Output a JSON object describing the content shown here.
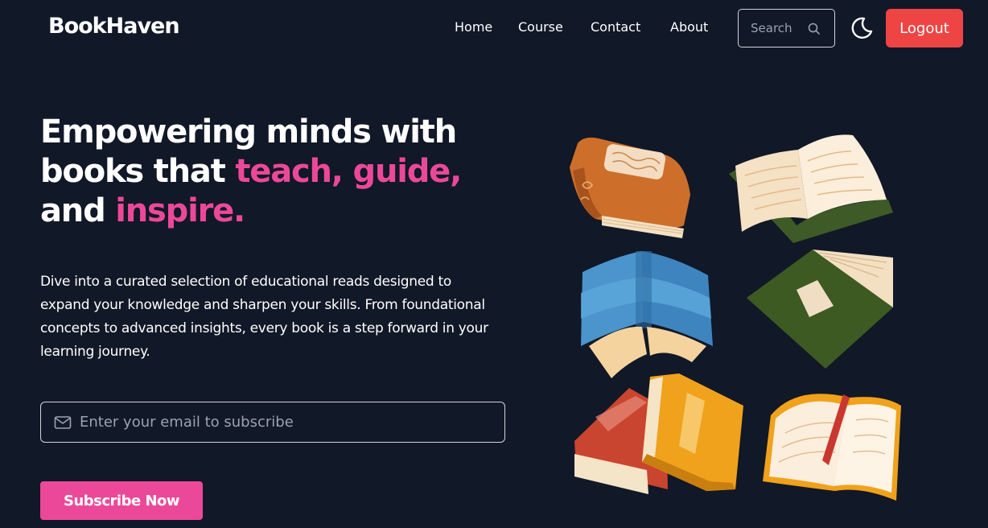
{
  "navbar": {
    "brand": "BookHaven",
    "links": [
      {
        "label": "Home"
      },
      {
        "label": "Course"
      },
      {
        "label": "Contact"
      },
      {
        "label": "About"
      }
    ],
    "search": {
      "placeholder": "Search",
      "icon": "search-icon"
    },
    "theme_toggle_icon": "moon-icon",
    "logout_label": "Logout"
  },
  "hero": {
    "title_line1": "Empowering minds with",
    "title_line2_plain": "books that ",
    "title_line2_highlight": "teach, guide,",
    "title_line3_plain": "and ",
    "title_line3_highlight": "inspire.",
    "description": "Dive into a curated selection of educational reads designed to expand your knowledge and sharpen your skills. From foundational concepts to advanced insights, every book is a step forward in your learning journey.",
    "email": {
      "placeholder": "Enter your email to subscribe",
      "value": "",
      "icon": "mail-icon"
    },
    "subscribe_label": "Subscribe Now"
  },
  "colors": {
    "background": "#111827",
    "accent_pink": "#ec4899",
    "logout_red": "#ef4444",
    "text": "#ffffff"
  }
}
